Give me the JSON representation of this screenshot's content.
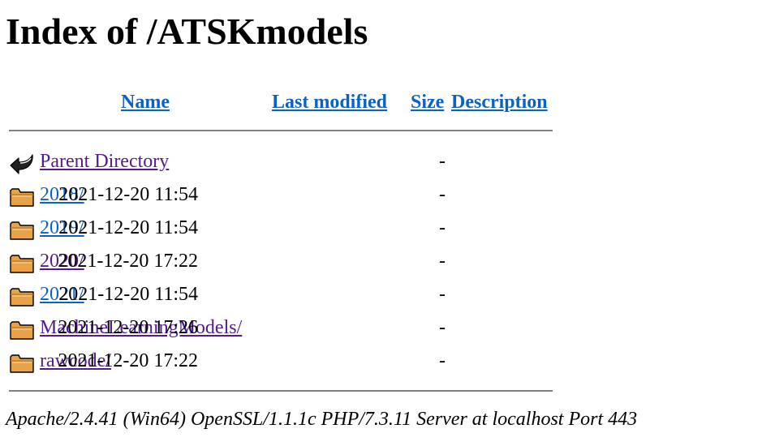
{
  "title": "Index of /ATSKmodels",
  "columns": {
    "name": "Name",
    "last_modified": "Last modified",
    "size": "Size",
    "description": "Description"
  },
  "rows": [
    {
      "icon": "back-arrow-icon",
      "name": "Parent Directory",
      "modified": "",
      "size": "-",
      "visited": true
    },
    {
      "icon": "folder-icon",
      "name": "2018/",
      "modified": "2021-12-20 11:54",
      "size": "-",
      "visited": false
    },
    {
      "icon": "folder-icon",
      "name": "2019/",
      "modified": "2021-12-20 11:54",
      "size": "-",
      "visited": false
    },
    {
      "icon": "folder-icon",
      "name": "2020/",
      "modified": "2021-12-20 17:22",
      "size": "-",
      "visited": true
    },
    {
      "icon": "folder-icon",
      "name": "2021/",
      "modified": "2021-12-20 11:54",
      "size": "-",
      "visited": false
    },
    {
      "icon": "folder-icon",
      "name": "MachineLearningModels/",
      "modified": "2021-12-20 17:26",
      "size": "-",
      "visited": true
    },
    {
      "icon": "folder-icon",
      "name": "rawcode/",
      "modified": "2021-12-20 17:22",
      "size": "-",
      "visited": true
    }
  ],
  "colors": {
    "link": "#0b62c4",
    "visited_link": "#551a8b",
    "rule": "#808080",
    "folder_fill": "#e8a24a",
    "folder_outline": "#000000"
  },
  "footer": "Apache/2.4.41 (Win64) OpenSSL/1.1.1c PHP/7.3.11 Server at localhost Port 443"
}
